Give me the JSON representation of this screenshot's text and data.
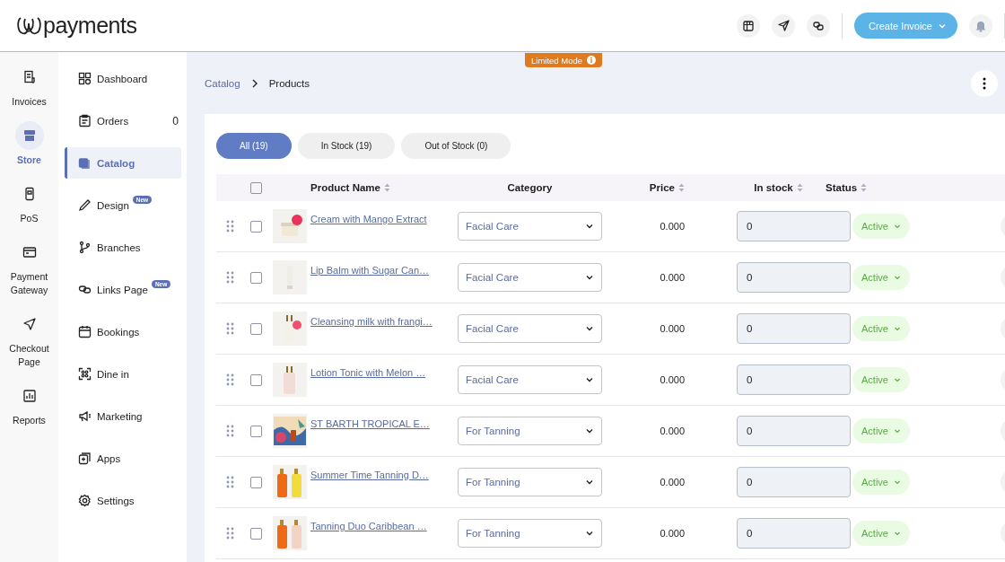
{
  "header": {
    "logo": "payments",
    "create_button": "Create Invoice",
    "limited_badge": "Limited Mode"
  },
  "rail": [
    {
      "label": "Invoices",
      "selected": false
    },
    {
      "label": "Store",
      "selected": true
    },
    {
      "label": "PoS",
      "selected": false
    },
    {
      "label": "Payment Gateway",
      "selected": false
    },
    {
      "label": "Checkout Page",
      "selected": false
    },
    {
      "label": "Reports",
      "selected": false
    }
  ],
  "sidebar": [
    {
      "label": "Dashboard",
      "selected": false
    },
    {
      "label": "Orders",
      "count": "0",
      "selected": false
    },
    {
      "label": "Catalog",
      "selected": true
    },
    {
      "label": "Design",
      "badge": "New",
      "selected": false
    },
    {
      "label": "Branches",
      "selected": false
    },
    {
      "label": "Links Page",
      "badge": "New",
      "selected": false
    },
    {
      "label": "Bookings",
      "selected": false
    },
    {
      "label": "Dine in",
      "selected": false
    },
    {
      "label": "Marketing",
      "selected": false
    },
    {
      "label": "Apps",
      "selected": false
    },
    {
      "label": "Settings",
      "selected": false
    }
  ],
  "breadcrumb": [
    "Catalog",
    "Products"
  ],
  "filter_tabs": [
    {
      "label": "All (19)",
      "selected": true
    },
    {
      "label": "In Stock (19)",
      "selected": false
    },
    {
      "label": "Out of Stock (0)",
      "selected": false
    }
  ],
  "table": {
    "select_all_checked": false,
    "columns": [
      {
        "label": "Product Name",
        "sortable": true
      },
      {
        "label": "Category",
        "sortable": false
      },
      {
        "label": "Price",
        "sortable": true
      },
      {
        "label": "In stock",
        "sortable": true
      },
      {
        "label": "Status",
        "sortable": true
      }
    ],
    "rows": [
      {
        "name": "Cream with Mango Extract",
        "category": "Facial Care",
        "price": "0.000",
        "stock": "0",
        "status": "Active",
        "checked": false
      },
      {
        "name": "Lip Balm with Sugar Can…",
        "category": "Facial Care",
        "price": "0.000",
        "stock": "0",
        "status": "Active",
        "checked": false
      },
      {
        "name": "Cleansing milk with frangi…",
        "category": "Facial Care",
        "price": "0.000",
        "stock": "0",
        "status": "Active",
        "checked": false
      },
      {
        "name": "Lotion Tonic with Melon …",
        "category": "Facial Care",
        "price": "0.000",
        "stock": "0",
        "status": "Active",
        "checked": false
      },
      {
        "name": "ST BARTH TROPICAL E…",
        "category": "For Tanning",
        "price": "0.000",
        "stock": "0",
        "status": "Active",
        "checked": false
      },
      {
        "name": "Summer Time Tanning D…",
        "category": "For Tanning",
        "price": "0.000",
        "stock": "0",
        "status": "Active",
        "checked": false
      },
      {
        "name": "Tanning Duo Caribbean …",
        "category": "For Tanning",
        "price": "0.000",
        "stock": "0",
        "status": "Active",
        "checked": false
      }
    ]
  }
}
